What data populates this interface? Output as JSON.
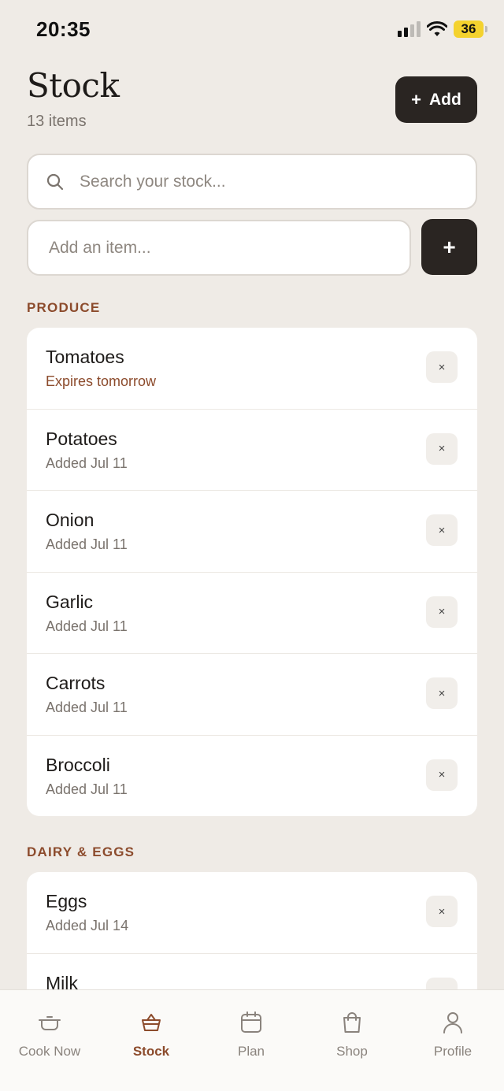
{
  "status_bar": {
    "time": "20:35",
    "battery": "36"
  },
  "header": {
    "title": "Stock",
    "count": "13 items",
    "add_label": "Add"
  },
  "search": {
    "placeholder": "Search your stock..."
  },
  "quick_add": {
    "placeholder": "Add an item...",
    "button_symbol": "+"
  },
  "sections": [
    {
      "heading": "PRODUCE",
      "items": [
        {
          "name": "Tomatoes",
          "sub": "Expires tomorrow"
        },
        {
          "name": "Potatoes",
          "sub": "Added Jul 11"
        },
        {
          "name": "Onion",
          "sub": "Added Jul 11"
        },
        {
          "name": "Garlic",
          "sub": "Added Jul 11"
        },
        {
          "name": "Carrots",
          "sub": "Added Jul 11"
        },
        {
          "name": "Broccoli",
          "sub": "Added Jul 11"
        }
      ]
    },
    {
      "heading": "DAIRY & EGGS",
      "items": [
        {
          "name": "Eggs",
          "sub": "Added Jul 14"
        },
        {
          "name": "Milk",
          "sub": ""
        }
      ]
    }
  ],
  "remove_symbol": "×",
  "nav": [
    {
      "label": "Cook Now",
      "icon": "pot-icon"
    },
    {
      "label": "Stock",
      "icon": "basket-icon"
    },
    {
      "label": "Plan",
      "icon": "calendar-icon"
    },
    {
      "label": "Shop",
      "icon": "shopping-bag-icon"
    },
    {
      "label": "Profile",
      "icon": "person-icon"
    }
  ],
  "colors": {
    "accent": "#8C4B2C",
    "dark_button": "#2A2522",
    "background": "#EFEBE6",
    "battery": "#F4D22E"
  }
}
